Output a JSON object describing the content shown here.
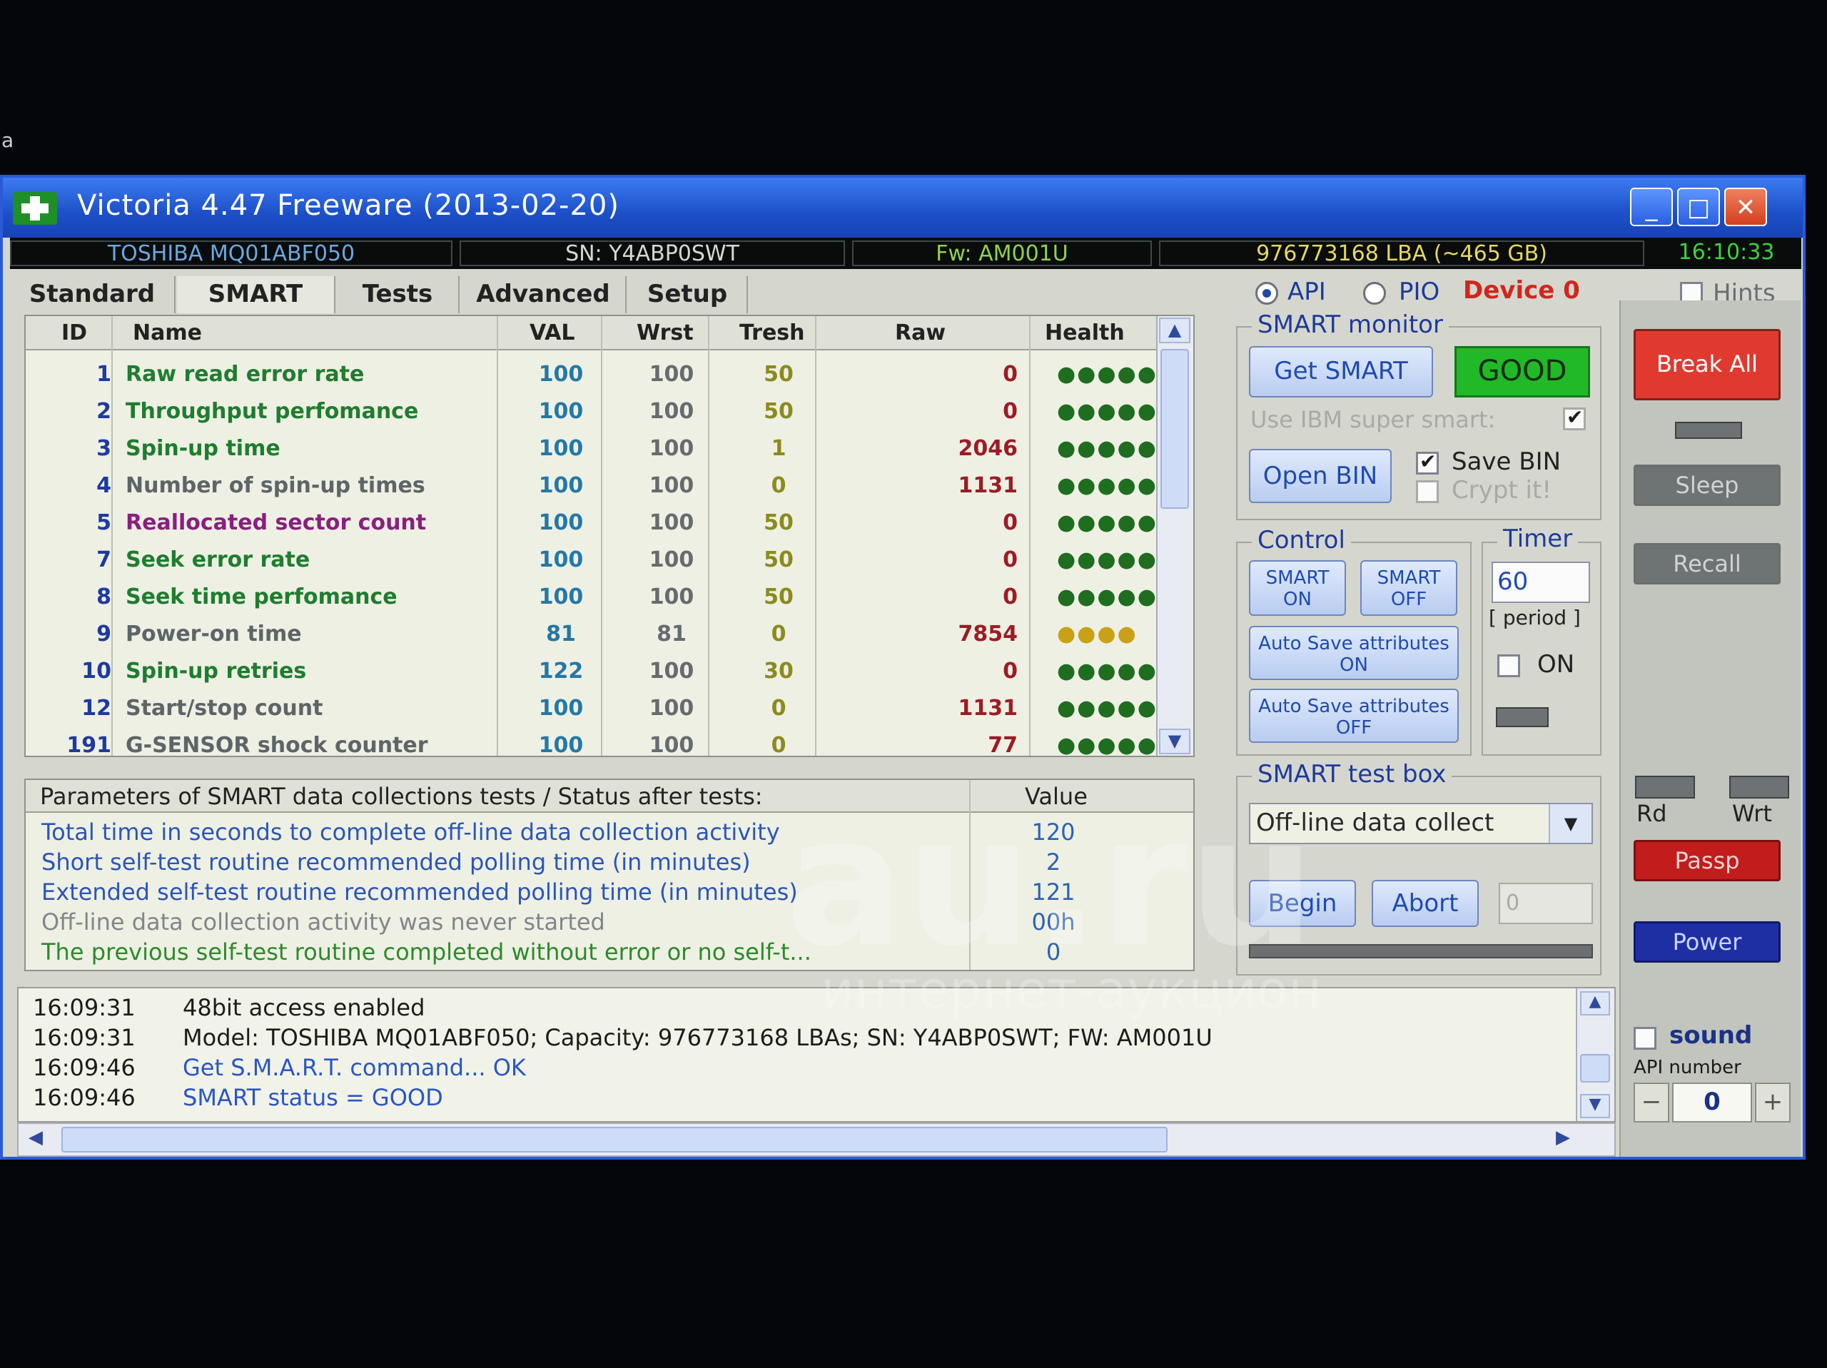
{
  "stray_char": "a",
  "window": {
    "title": "Victoria 4.47  Freeware (2013-02-20)"
  },
  "info": {
    "model": "TOSHIBA MQ01ABF050",
    "serial": "SN: Y4ABP0SWT",
    "firmware": "Fw: AM001U",
    "lba": "976773168 LBA (~465 GB)",
    "clock": "16:10:33"
  },
  "tabs": [
    "Standard",
    "SMART",
    "Tests",
    "Advanced",
    "Setup"
  ],
  "mode": {
    "api": "API",
    "pio": "PIO",
    "device": "Device 0",
    "hints": "Hints"
  },
  "smart_table": {
    "headers": {
      "id": "ID",
      "name": "Name",
      "val": "VAL",
      "wrst": "Wrst",
      "tresh": "Tresh",
      "raw": "Raw",
      "health": "Health"
    },
    "rows": [
      {
        "id": "1",
        "name": "Raw read error rate",
        "val": "100",
        "wrst": "100",
        "tresh": "50",
        "raw": "0",
        "health": "●●●●●",
        "name_color": "#1f7d2e",
        "health_color": "#1f6d1f"
      },
      {
        "id": "2",
        "name": "Throughput perfomance",
        "val": "100",
        "wrst": "100",
        "tresh": "50",
        "raw": "0",
        "health": "●●●●●",
        "name_color": "#1f7d2e",
        "health_color": "#1f6d1f"
      },
      {
        "id": "3",
        "name": "Spin-up time",
        "val": "100",
        "wrst": "100",
        "tresh": "1",
        "raw": "2046",
        "health": "●●●●●",
        "name_color": "#1f7d2e",
        "health_color": "#1f6d1f"
      },
      {
        "id": "4",
        "name": "Number of spin-up times",
        "val": "100",
        "wrst": "100",
        "tresh": "0",
        "raw": "1131",
        "health": "●●●●●",
        "name_color": "#5d6567",
        "health_color": "#1f6d1f"
      },
      {
        "id": "5",
        "name": "Reallocated sector count",
        "val": "100",
        "wrst": "100",
        "tresh": "50",
        "raw": "0",
        "health": "●●●●●",
        "name_color": "#8a1f7f",
        "health_color": "#1f6d1f"
      },
      {
        "id": "7",
        "name": "Seek error rate",
        "val": "100",
        "wrst": "100",
        "tresh": "50",
        "raw": "0",
        "health": "●●●●●",
        "name_color": "#1f7d2e",
        "health_color": "#1f6d1f"
      },
      {
        "id": "8",
        "name": "Seek time perfomance",
        "val": "100",
        "wrst": "100",
        "tresh": "50",
        "raw": "0",
        "health": "●●●●●",
        "name_color": "#1f7d2e",
        "health_color": "#1f6d1f"
      },
      {
        "id": "9",
        "name": "Power-on time",
        "val": "81",
        "wrst": "81",
        "tresh": "0",
        "raw": "7854",
        "health": "●●●●",
        "name_color": "#5d6567",
        "health_color": "#c8a116"
      },
      {
        "id": "10",
        "name": "Spin-up retries",
        "val": "122",
        "wrst": "100",
        "tresh": "30",
        "raw": "0",
        "health": "●●●●●",
        "name_color": "#1f7d2e",
        "health_color": "#1f6d1f"
      },
      {
        "id": "12",
        "name": "Start/stop count",
        "val": "100",
        "wrst": "100",
        "tresh": "0",
        "raw": "1131",
        "health": "●●●●●",
        "name_color": "#5d6567",
        "health_color": "#1f6d1f"
      },
      {
        "id": "191",
        "name": "G-SENSOR shock counter",
        "val": "100",
        "wrst": "100",
        "tresh": "0",
        "raw": "77",
        "health": "●●●●●",
        "name_color": "#5d6567",
        "health_color": "#1f6d1f"
      }
    ]
  },
  "params": {
    "header": "Parameters of SMART data collections tests / Status after tests:",
    "value_header": "Value",
    "rows": [
      {
        "text": "Total time in seconds to complete off-line data collection activity",
        "value": "120",
        "color": "#2a56b8"
      },
      {
        "text": "Short self-test routine recommended polling time (in minutes)",
        "value": "2",
        "color": "#2a56b8"
      },
      {
        "text": "Extended self-test routine recommended polling time (in minutes)",
        "value": "121",
        "color": "#2a56b8"
      },
      {
        "text": "Off-line data collection activity was never started",
        "value": "00h",
        "color": "#80868a"
      },
      {
        "text": "The previous self-test routine completed without error or no self-t...",
        "value": "0",
        "color": "#2d8a2a"
      }
    ]
  },
  "smart_monitor": {
    "title": "SMART monitor",
    "get_smart": "Get SMART",
    "status": "GOOD",
    "ibm": "Use IBM super smart:",
    "open_bin": "Open BIN",
    "save_bin": "Save BIN",
    "crypt": "Crypt it!"
  },
  "control": {
    "title": "Control",
    "smart_on": "SMART ON",
    "smart_off": "SMART OFF",
    "autosave_on": "Auto Save attributes ON",
    "autosave_off": "Auto Save attributes OFF"
  },
  "timer": {
    "title": "Timer",
    "value": "60",
    "period": "[ period ]",
    "on": "ON"
  },
  "test_box": {
    "title": "SMART test box",
    "selected": "Off-line data collect",
    "begin": "Begin",
    "abort": "Abort",
    "counter": "0"
  },
  "right": {
    "break_all": "Break All",
    "sleep": "Sleep",
    "recall": "Recall",
    "rd": "Rd",
    "wrt": "Wrt",
    "passp": "Passp",
    "power": "Power",
    "sound": "sound",
    "api_number_label": "API number",
    "api_number": "0",
    "minus": "−",
    "plus": "+"
  },
  "log": [
    {
      "time": "16:09:31",
      "msg": "48bit access enabled",
      "color": "#1c1c1c"
    },
    {
      "time": "16:09:31",
      "msg": "Model: TOSHIBA MQ01ABF050; Capacity: 976773168 LBAs; SN: Y4ABP0SWT; FW: AM001U",
      "color": "#1c1c1c"
    },
    {
      "time": "16:09:46",
      "msg": "Get S.M.A.R.T. command... OK",
      "color": "#2a56c4"
    },
    {
      "time": "16:09:46",
      "msg": "SMART status = GOOD",
      "color": "#2a56c4"
    }
  ],
  "watermark": {
    "main": "au.ru",
    "sub": "интернет-аукцион"
  }
}
